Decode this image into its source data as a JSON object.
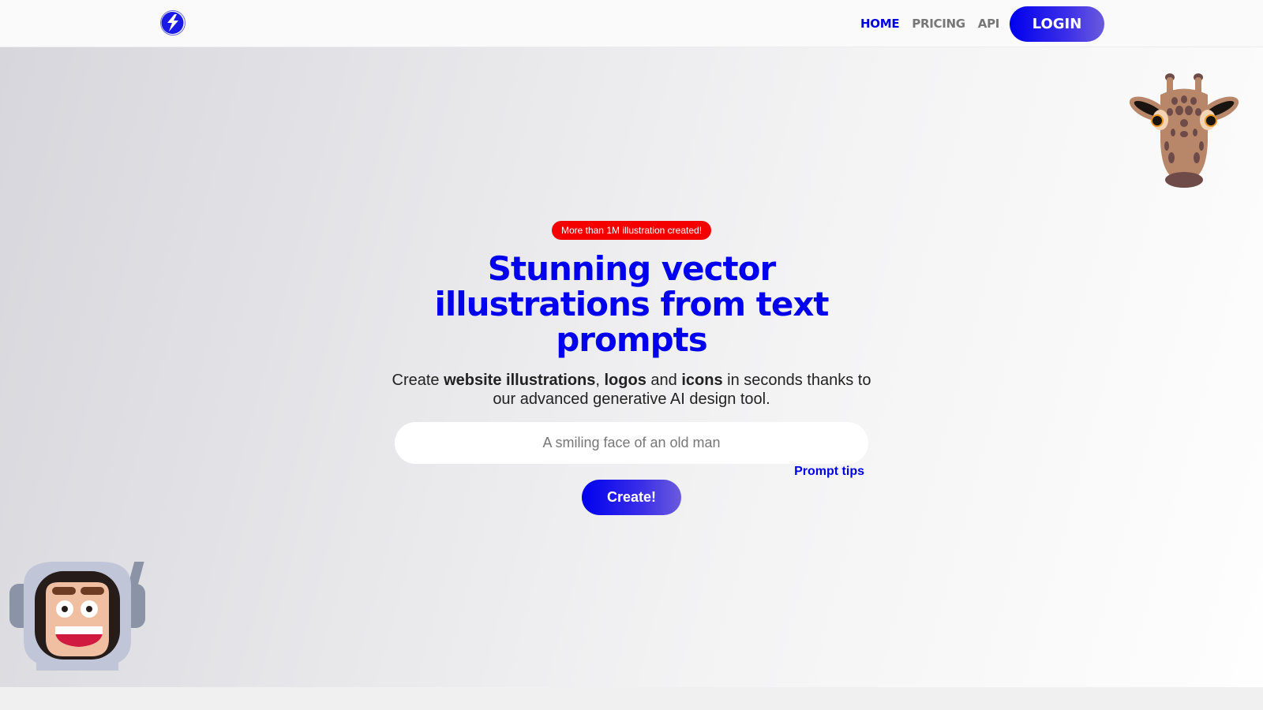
{
  "navbar": {
    "logo_icon": "lightning-bolt-logo-icon",
    "links": [
      {
        "label": "HOME",
        "active": true
      },
      {
        "label": "PRICING",
        "active": false
      },
      {
        "label": "API",
        "active": false
      }
    ],
    "login_label": "LOGIN"
  },
  "hero": {
    "badge": "More than 1M illustration created!",
    "headline": "Stunning vector illustrations from text prompts",
    "subtitle": {
      "prefix": "Create ",
      "term1": "website illustrations",
      "sep1": ", ",
      "term2": "logos",
      "sep2": " and ",
      "term3": "icons",
      "suffix": " in seconds thanks to our advanced generative AI design tool."
    },
    "prompt_placeholder": "A smiling face of an old man",
    "prompt_value": "",
    "prompt_tips_label": "Prompt tips",
    "create_label": "Create!"
  },
  "illustrations": {
    "top_right": "giraffe-head-illustration",
    "bottom_left": "astronaut-face-illustration"
  },
  "colors": {
    "brand_blue": "#0000ee",
    "badge_red": "#f40000",
    "nav_inactive": "#777777"
  }
}
